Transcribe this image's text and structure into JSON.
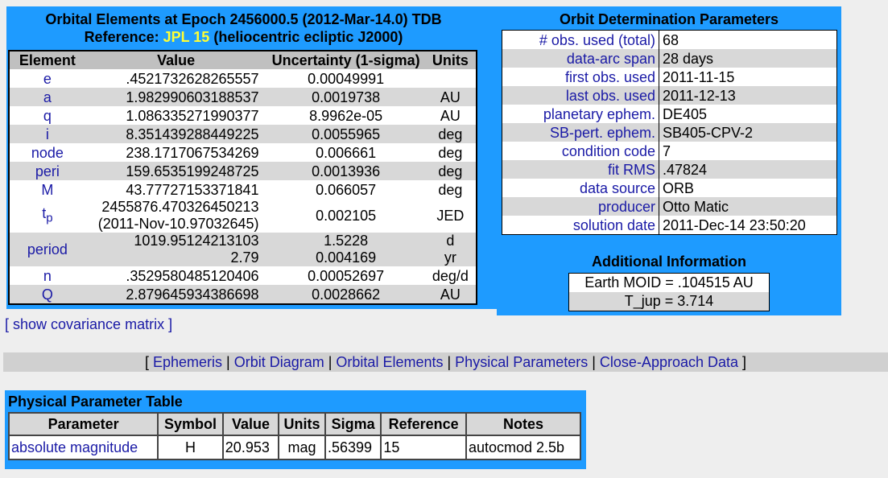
{
  "elements": {
    "title": "Orbital Elements at Epoch 2456000.5 (2012-Mar-14.0) TDB",
    "reference_prefix": "Reference: ",
    "reference_link": "JPL 15",
    "reference_suffix": " (heliocentric ecliptic J2000)",
    "headers": [
      "Element",
      "Value",
      "Uncertainty (1-sigma)",
      "Units"
    ],
    "rows": [
      {
        "name": "e",
        "value": ".4521732628265557",
        "unc": "0.00049991",
        "units": ""
      },
      {
        "name": "a",
        "value": "1.982990603188537",
        "unc": "0.0019738",
        "units": "AU"
      },
      {
        "name": "q",
        "value": "1.086335271990377",
        "unc": "8.9962e-05",
        "units": "AU"
      },
      {
        "name": "i",
        "value": "8.351439288449225",
        "unc": "0.0055965",
        "units": "deg"
      },
      {
        "name": "node",
        "value": "238.1717067534269",
        "unc": "0.006661",
        "units": "deg"
      },
      {
        "name": "peri",
        "value": "159.6535199248725",
        "unc": "0.0013936",
        "units": "deg"
      },
      {
        "name": "M",
        "value": "43.77727153371841",
        "unc": "0.066057",
        "units": "deg"
      }
    ],
    "tp": {
      "name": "t",
      "sub": "p",
      "value1": "2455876.470326450213",
      "value2": "(2011-Nov-10.97032645)",
      "unc": "0.002105",
      "units": "JED"
    },
    "period": {
      "name": "period",
      "value1": "1019.95124213103",
      "value2": "2.79",
      "unc1": "1.5228",
      "unc2": "0.004169",
      "units1": "d",
      "units2": "yr"
    },
    "rows2": [
      {
        "name": "n",
        "value": ".3529580485120406",
        "unc": "0.00052697",
        "units": "deg/d"
      },
      {
        "name": "Q",
        "value": "2.879645934386698",
        "unc": "0.0028662",
        "units": "AU"
      }
    ]
  },
  "od": {
    "title": "Orbit Determination Parameters",
    "rows": [
      {
        "label": "# obs. used (total)",
        "value": "68"
      },
      {
        "label": "data-arc span",
        "value": "28 days"
      },
      {
        "label": "first obs. used",
        "value": "2011-11-15"
      },
      {
        "label": "last obs. used",
        "value": "2011-12-13"
      },
      {
        "label": "planetary ephem.",
        "value": "DE405"
      },
      {
        "label": "SB-pert. ephem.",
        "value": "SB405-CPV-2"
      },
      {
        "label": "condition code",
        "value": "7"
      },
      {
        "label": "fit RMS",
        "value": ".47824"
      },
      {
        "label": "data source",
        "value": "ORB"
      },
      {
        "label": "producer",
        "value": "Otto Matic"
      },
      {
        "label": "solution date",
        "value": "2011-Dec-14 23:50:20"
      }
    ]
  },
  "additional": {
    "title": "Additional Information",
    "moid": "Earth MOID = .104515 AU",
    "tjup": "T_jup = 3.714"
  },
  "covariance_link": "[ show covariance matrix ]",
  "nav": {
    "open": "[ ",
    "close": " ]",
    "sep": " | ",
    "links": [
      "Ephemeris",
      "Orbit Diagram",
      "Orbital Elements",
      "Physical Parameters",
      "Close-Approach Data"
    ]
  },
  "physical": {
    "title": "Physical Parameter Table",
    "headers": [
      "Parameter",
      "Symbol",
      "Value",
      "Units",
      "Sigma",
      "Reference",
      "Notes"
    ],
    "row": {
      "parameter": "absolute magnitude",
      "symbol": "H",
      "value": "20.953",
      "units": "mag",
      "sigma": ".56399",
      "reference": "15",
      "notes": "autocmod 2.5b"
    }
  }
}
